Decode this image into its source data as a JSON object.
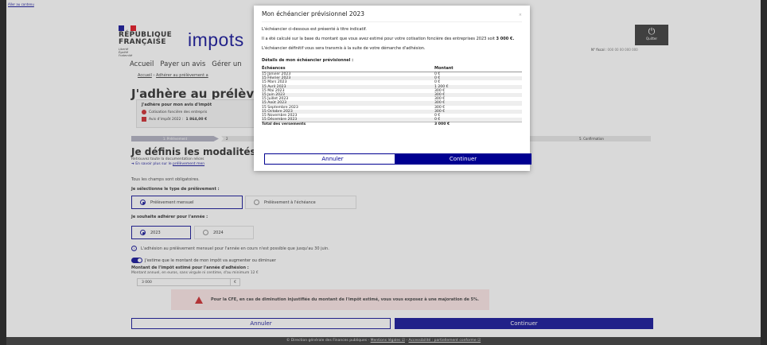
{
  "skip_link": "Aller au contenu",
  "header": {
    "flag_colors": [
      "#000091",
      "#ffffff",
      "#e1000f"
    ],
    "republique": "RÉPUBLIQUE",
    "francaise": "FRANÇAISE",
    "motto": [
      "Liberté",
      "Égalité",
      "Fraternité"
    ],
    "brand": "impots",
    "quit_label": "Quitter",
    "fiscal_label": "N° fiscal :",
    "fiscal_value": "000 00 00 000 000"
  },
  "nav": {
    "items": [
      "Accueil",
      "Payer un avis",
      "Gérer un"
    ]
  },
  "breadcrumb": {
    "home": "Accueil",
    "sep": "›",
    "current": "Adhérer au prélèvement a"
  },
  "page_title": "J'adhère au prélèvemen",
  "avis_box": {
    "title": "J'adhère pour mon avis d'impôt",
    "row1": "Cotisation foncière des entrepris",
    "row2_prefix": "Avis d'impôt 2022 :",
    "row2_value": "1 864,00 €"
  },
  "steps": {
    "step1": "1. Prélèvement",
    "step2": "2",
    "step5": "5. Confirmation"
  },
  "section_title": "Je définis les modalités",
  "doc_line": "Retrouvez toute la documentation néces",
  "doc_link_prefix": "➜  En savoir plus sur le",
  "doc_link": "prélèvement men",
  "required_note": "Tous les champs sont obligatoires.",
  "question_type": "Je sélectionne le type de prélèvement :",
  "opt_mensuel": "Prélèvement mensuel",
  "opt_echeance": "Prélèvement à l'échéance",
  "question_year": "Je souhaite adhérer pour l'année :",
  "opt_2023": "2023",
  "opt_2024": "2024",
  "info_icon": "i",
  "info_text": "L'adhésion au prélèvement mensuel pour l'année en cours n'est possible que jusqu'au 30 juin.",
  "toggle_text": "J'estime que le montant de mon impôt va augmenter ou diminuer",
  "amount_label": "Montant de l'impôt estimé pour l'année d'adhésion :",
  "amount_hint": "Montant annuel, en euros, sans virgule ni centime, d'au minimum 12 €",
  "amount_value": "3 000",
  "amount_unit": "€",
  "warning": "Pour la CFE, en cas de diminution injustifiée du montant de l'impôt estimé, vous vous exposez à une majoration de 5%.",
  "btn_cancel": "Annuler",
  "btn_continue": "Continuer",
  "footer": {
    "copyright": "© Direction générale des Finances publiques -",
    "legal": "Mentions légales ☑",
    "sep": " - ",
    "access": "Accessibilité : partiellement conforme ☑"
  },
  "modal": {
    "title": "Mon échéancier prévisionnel 2023",
    "close": "×",
    "p1": "L'échéancier ci-dessous est présenté à titre indicatif.",
    "p2_a": "Il a été calculé sur la base du montant que vous avez estimé pour votre cotisation foncière des entreprises 2023 soit ",
    "p2_b": "3 000 €.",
    "p3": "L'échéancier définitif vous sera transmis à la suite de votre démarche d'adhésion.",
    "details": "Détails de mon échéancier prévisionnel :",
    "col_date": "Échéances",
    "col_amount": "Montant",
    "rows": [
      [
        "15 Janvier 2023",
        "0 €"
      ],
      [
        "15 Février 2023",
        "0 €"
      ],
      [
        "15 Mars 2023",
        "0 €"
      ],
      [
        "15 Avril 2023",
        "1 200 €"
      ],
      [
        "15 Mai 2023",
        "300 €"
      ],
      [
        "15 Juin 2023",
        "300 €"
      ],
      [
        "15 Juillet 2023",
        "300 €"
      ],
      [
        "15 Août 2023",
        "300 €"
      ],
      [
        "15 Septembre 2023",
        "300 €"
      ],
      [
        "15 Octobre 2023",
        "300 €"
      ],
      [
        "15 Novembre 2023",
        "0 €"
      ],
      [
        "15 Décembre 2023",
        "0 €"
      ]
    ],
    "total_label": "Total des versements",
    "total_value": "3 000 €",
    "cancel": "Annuler",
    "continue": "Continuer"
  }
}
